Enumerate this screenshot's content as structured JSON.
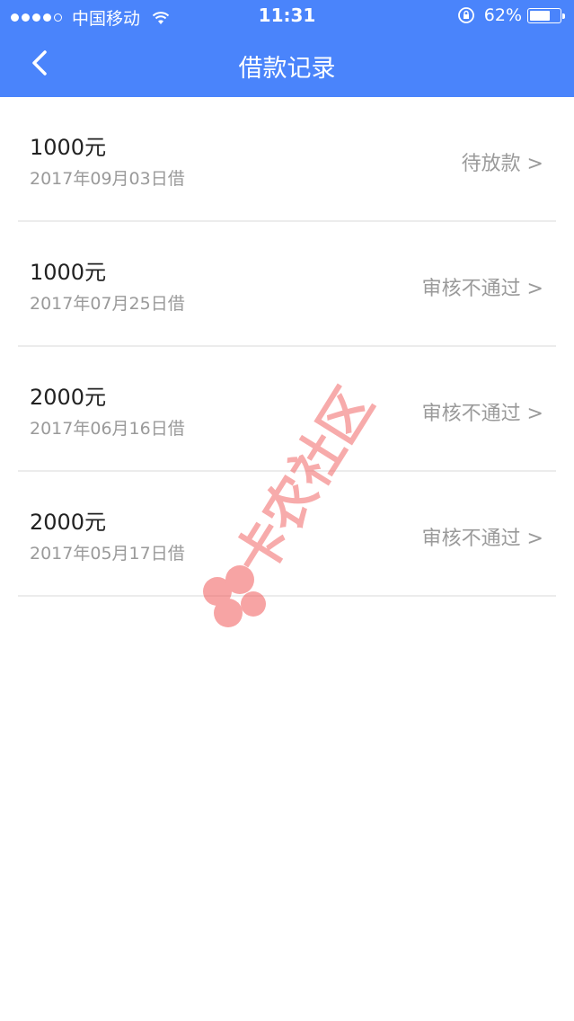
{
  "status_bar": {
    "carrier": "中国移动",
    "time": "11:31",
    "battery": "62%",
    "battery_level": 0.62
  },
  "nav": {
    "title": "借款记录",
    "back_icon": "chevron-left-icon"
  },
  "records": [
    {
      "amount": "1000元",
      "date": "2017年09月03日借",
      "status": "待放款 >"
    },
    {
      "amount": "1000元",
      "date": "2017年07月25日借",
      "status": "审核不通过 >"
    },
    {
      "amount": "2000元",
      "date": "2017年06月16日借",
      "status": "审核不通过 >"
    },
    {
      "amount": "2000元",
      "date": "2017年05月17日借",
      "status": "审核不通过 >"
    }
  ],
  "watermark": {
    "text": "卡农社区",
    "color": "#f15a5a"
  },
  "colors": {
    "header": "#4a84fb",
    "divider": "#ececec",
    "secondary_text": "#9a9a9a"
  }
}
